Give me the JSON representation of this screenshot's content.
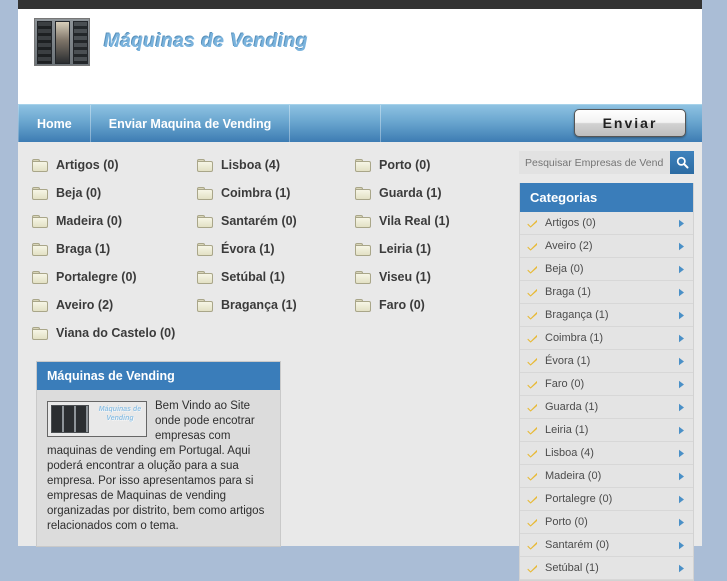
{
  "site": {
    "logo_text": "Máquinas de Vending",
    "logo_icon": "vending-machine-image"
  },
  "nav": {
    "items": [
      {
        "label": "Home"
      },
      {
        "label": "Enviar Maquina de Vending"
      }
    ],
    "submit_button": "Enviar"
  },
  "main": {
    "folders": [
      {
        "label": "Artigos (0)"
      },
      {
        "label": "Lisboa (4)"
      },
      {
        "label": "Porto (0)"
      },
      {
        "label": "Beja (0)"
      },
      {
        "label": "Coimbra (1)"
      },
      {
        "label": "Guarda (1)"
      },
      {
        "label": "Madeira (0)"
      },
      {
        "label": "Santarém (0)"
      },
      {
        "label": "Vila Real (1)"
      },
      {
        "label": "Braga (1)"
      },
      {
        "label": "Évora (1)"
      },
      {
        "label": "Leiria (1)"
      },
      {
        "label": "Portalegre (0)"
      },
      {
        "label": "Setúbal (1)"
      },
      {
        "label": "Viseu (1)"
      },
      {
        "label": "Aveiro (2)"
      },
      {
        "label": "Bragança (1)"
      },
      {
        "label": "Faro (0)"
      },
      {
        "label": "Viana do Castelo (0)"
      },
      {
        "label": ""
      },
      {
        "label": ""
      }
    ]
  },
  "welcome": {
    "title": "Máquinas de Vending",
    "thumb_text": "Máquinas de Vending",
    "body": "Bem Vindo ao Site onde pode encotrar empresas com maquinas de vending em Portugal. Aqui poderá encontrar a olução para a sua empresa. Por isso apresentamos para si empresas de Maquinas de vending organizadas por distrito, bem como artigos relacionados com o tema."
  },
  "sidebar": {
    "search": {
      "placeholder": "Pesquisar Empresas de Vending",
      "value": "",
      "button_icon": "search-icon"
    },
    "categories_title": "Categorias",
    "categories": [
      {
        "label": "Artigos (0)"
      },
      {
        "label": "Aveiro (2)"
      },
      {
        "label": "Beja (0)"
      },
      {
        "label": "Braga (1)"
      },
      {
        "label": "Bragança (1)"
      },
      {
        "label": "Coimbra (1)"
      },
      {
        "label": "Évora (1)"
      },
      {
        "label": "Faro (0)"
      },
      {
        "label": "Guarda (1)"
      },
      {
        "label": "Leiria (1)"
      },
      {
        "label": "Lisboa (4)"
      },
      {
        "label": "Madeira (0)"
      },
      {
        "label": "Portalegre (0)"
      },
      {
        "label": "Porto (0)"
      },
      {
        "label": "Santarém (0)"
      },
      {
        "label": "Setúbal (1)"
      }
    ]
  },
  "colors": {
    "page_background": "#aabdd6",
    "topbar": "#333333",
    "nav_gradient_top": "#8ec2e2",
    "nav_gradient_bottom": "#3d7cb3",
    "panel_header_blue": "#3a7dba",
    "content_background": "#e9e9e9",
    "check_yellow": "#e8b933",
    "arrow_blue": "#3f83bd",
    "folder_beige": "#e3e1c4"
  }
}
